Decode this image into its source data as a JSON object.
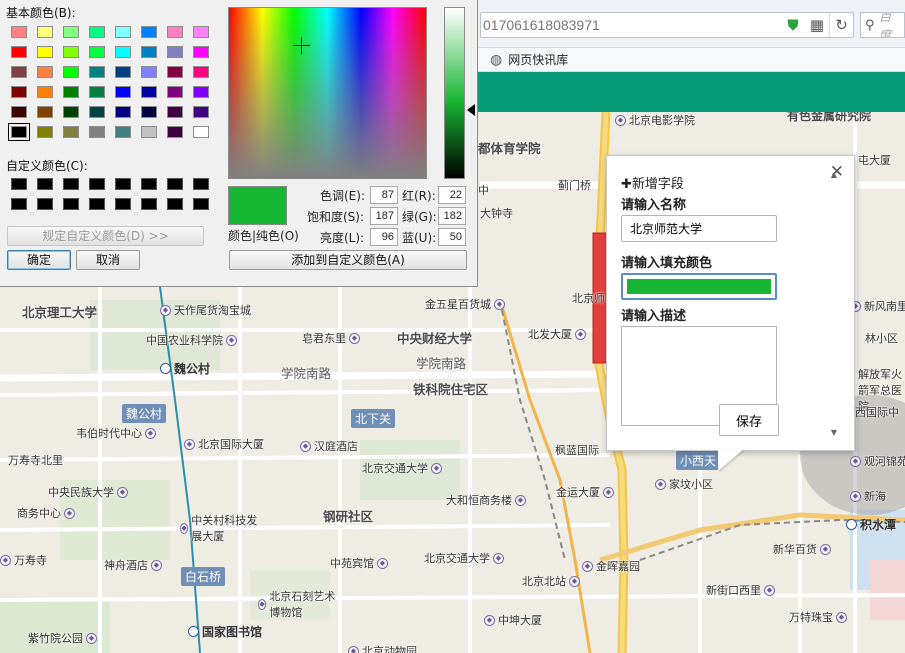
{
  "map": {
    "areas": [
      "北京理工大学",
      "中央财经大学",
      "铁科院住宅区",
      "钢研社区",
      "都体育学院",
      "北京体育学院"
    ],
    "roads": [
      "学院南路",
      "学院南路"
    ],
    "badges": [
      "魏公村",
      "北下关",
      "白石桥",
      "小西天"
    ],
    "metro": [
      "魏公村",
      "国家图书馆",
      "积水潭"
    ],
    "pois": [
      "天作尾货淘宝城",
      "中国农业科学院",
      "皂君东里",
      "金五星百货城",
      "北京电影学院",
      "北发大厦",
      "韦伯时代中心",
      "北京国际大厦",
      "汉庭酒店",
      "北京交通大学",
      "大和恒商务楼",
      "金运大厦",
      "枫蓝国际",
      "家坟小区",
      "中央民族大学",
      "商务中心",
      "中关村科技发展大厦",
      "中苑宾馆",
      "北京交通大学",
      "北京北站",
      "金晖嘉园",
      "神舟酒店",
      "北京石刻艺术博物馆",
      "中坤大厦",
      "新街口西里",
      "万特珠宝",
      "新华百货",
      "观河锦苑",
      "新海",
      "北京师",
      "解放军火箭军总医院",
      "西国际中",
      "新风南里",
      "林小区",
      "万寿寺北里",
      "万寿寺",
      "紫竹院公园",
      "北京动物园",
      "蓟门桥",
      "大钟寺",
      "中",
      "有色金属研究院",
      "屯大厦"
    ]
  },
  "browser": {
    "url": "017061618083971",
    "search_placeholder": "百度",
    "bookmark": "网页快讯库"
  },
  "popup": {
    "title": "✚新增字段",
    "name_label": "请输入名称",
    "name_value": "北京师范大学",
    "color_label": "请输入填充颜色",
    "fill_color": "#16b632",
    "desc_label": "请输入描述",
    "desc_value": "",
    "save_label": "保存",
    "close": "✕"
  },
  "dialog": {
    "basic_colors_label": "基本颜色(B):",
    "custom_colors_label": "自定义颜色(C):",
    "define_custom_label": "规定自定义颜色(D) >>",
    "ok_label": "确定",
    "cancel_label": "取消",
    "color_solid_label": "颜色|纯色(O)",
    "add_custom_label": "添加到自定义颜色(A)",
    "hue_label": "色调(E):",
    "sat_label": "饱和度(S):",
    "lum_label": "亮度(L):",
    "red_label": "红(R):",
    "green_label": "绿(G):",
    "blue_label": "蓝(U):",
    "hue": "87",
    "sat": "187",
    "lum": "96",
    "red": "22",
    "green": "182",
    "blue": "50",
    "basic_colors": [
      [
        "#ff8080",
        "#ffff80",
        "#80ff80",
        "#00ff80",
        "#80ffff",
        "#0080ff",
        "#ff80c0",
        "#ff80ff"
      ],
      [
        "#ff0000",
        "#ffff00",
        "#80ff00",
        "#00ff40",
        "#00ffff",
        "#0080c0",
        "#8080c0",
        "#ff00ff"
      ],
      [
        "#804040",
        "#ff8040",
        "#00ff00",
        "#008080",
        "#004080",
        "#8080ff",
        "#800040",
        "#ff0080"
      ],
      [
        "#800000",
        "#ff8000",
        "#008000",
        "#008040",
        "#0000ff",
        "#0000a0",
        "#800080",
        "#8000ff"
      ],
      [
        "#400000",
        "#804000",
        "#004000",
        "#004040",
        "#000080",
        "#000040",
        "#400040",
        "#400080"
      ],
      [
        "#000000",
        "#808000",
        "#808040",
        "#808080",
        "#408080",
        "#c0c0c0",
        "#400040",
        "#ffffff"
      ]
    ]
  }
}
